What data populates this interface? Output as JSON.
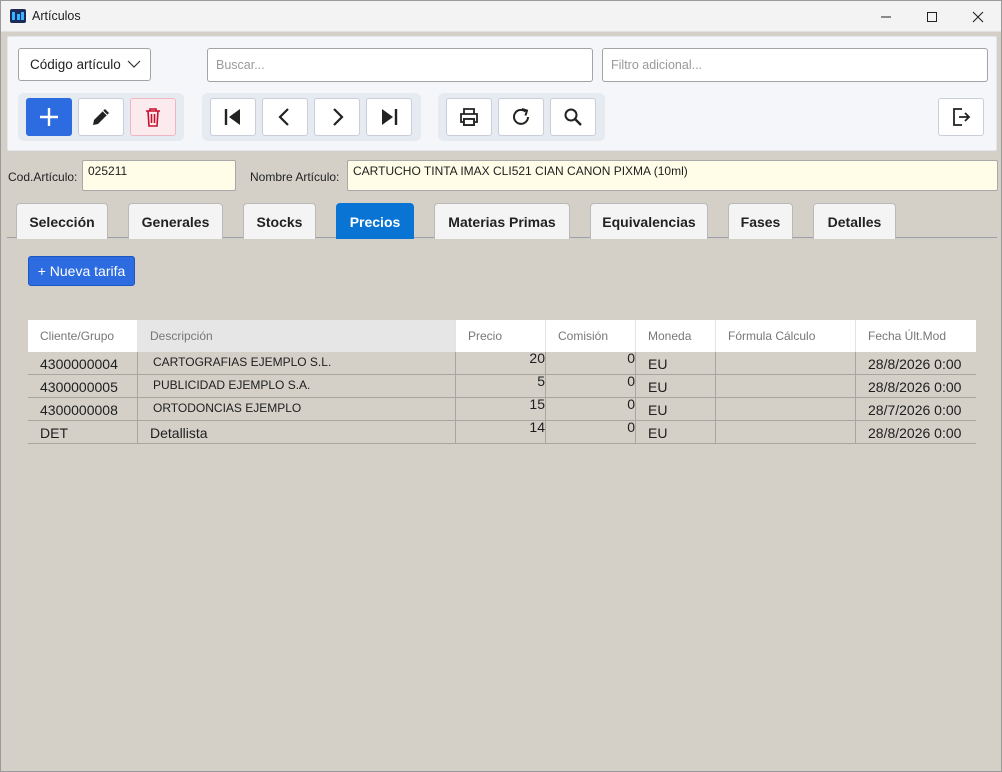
{
  "window": {
    "title": "Artículos"
  },
  "toolbar": {
    "select_value": "Código artículo",
    "search_placeholder": "Buscar...",
    "filter_placeholder": "Filtro adicional..."
  },
  "article": {
    "code_label": "Cod.Artículo:",
    "code_value": "025211",
    "name_label": "Nombre Artículo:",
    "name_value": "CARTUCHO TINTA IMAX CLI521 CIAN CANON PIXMA (10ml)"
  },
  "tabs": [
    "Selección",
    "Generales",
    "Stocks",
    "Precios",
    "Materias Primas",
    "Equivalencias",
    "Fases",
    "Detalles"
  ],
  "active_tab": "Precios",
  "new_rate_label": "+ Nueva tarifa",
  "table": {
    "headers": [
      "Cliente/Grupo",
      "Descripción",
      "Precio",
      "Comisión",
      "Moneda",
      "Fórmula Cálculo",
      "Fecha Últ.Mod"
    ],
    "rows": [
      {
        "cliente": "4300000004",
        "descripcion": "CARTOGRAFIAS EJEMPLO S.L.",
        "precio": "20",
        "comision": "0",
        "moneda": "EU",
        "formula": "",
        "fecha": "28/8/2026 0:00"
      },
      {
        "cliente": "4300000005",
        "descripcion": "PUBLICIDAD EJEMPLO S.A.",
        "precio": "5",
        "comision": "0",
        "moneda": "EU",
        "formula": "",
        "fecha": "28/8/2026 0:00"
      },
      {
        "cliente": "4300000008",
        "descripcion": "ORTODONCIAS EJEMPLO",
        "precio": "15",
        "comision": "0",
        "moneda": "EU",
        "formula": "",
        "fecha": "28/7/2026 0:00"
      },
      {
        "cliente": "DET",
        "descripcion": "Detallista",
        "precio": "14",
        "comision": "0",
        "moneda": "EU",
        "formula": "",
        "fecha": "28/8/2026 0:00"
      }
    ]
  },
  "colors": {
    "accent": "#2c6be0",
    "active_tab": "#0a74d4",
    "danger": "#c8102e",
    "field_bg": "#fffde8"
  }
}
